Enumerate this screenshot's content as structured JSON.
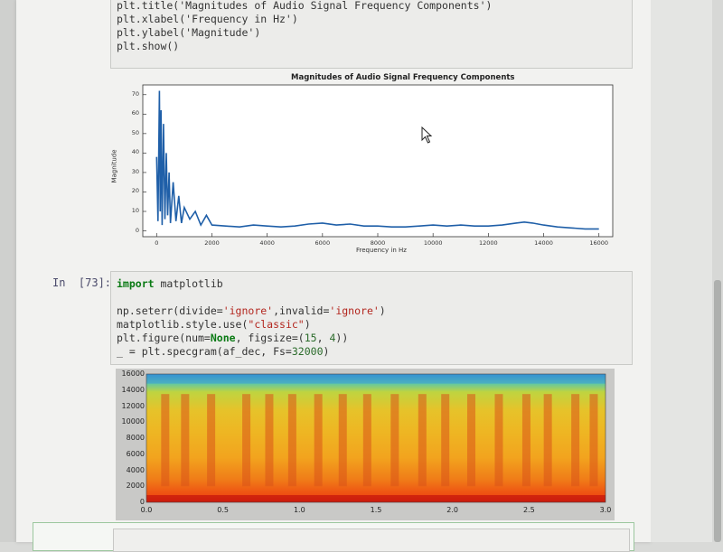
{
  "top_cell": {
    "lines": [
      "plt.title('Magnitudes of Audio Signal Frequency Components')",
      "plt.xlabel('Frequency in Hz')",
      "plt.ylabel('Magnitude')",
      "plt.show()"
    ]
  },
  "cell73": {
    "prompt": "In  [73]:",
    "line1_kw": "import",
    "line1_rest": " matplotlib",
    "line2_a": "np.seterr(divide=",
    "line2_s1": "'ignore'",
    "line2_b": ",invalid=",
    "line2_s2": "'ignore'",
    "line2_c": ")",
    "line3_a": "matplotlib.style.use(",
    "line3_s": "\"classic\"",
    "line3_c": ")",
    "line4_a": "plt.figure(num=",
    "line4_kw": "None",
    "line4_b": ", figsize=(",
    "line4_n1": "15",
    "line4_c": ", ",
    "line4_n2": "4",
    "line4_d": "))",
    "line5_a": "_ = plt.specgram(af_dec, Fs=",
    "line5_n": "32000",
    "line5_c": ")"
  },
  "chart_data": [
    {
      "type": "line",
      "title": "Magnitudes of Audio Signal Frequency Components",
      "xlabel": "Frequency in Hz",
      "ylabel": "Magnitude",
      "xlim": [
        -500,
        16500
      ],
      "ylim": [
        -3,
        75
      ],
      "xticks": [
        "0",
        "2000",
        "4000",
        "6000",
        "8000",
        "10000",
        "12000",
        "14000",
        "16000"
      ],
      "yticks": [
        "0",
        "10",
        "20",
        "30",
        "40",
        "50",
        "60",
        "70"
      ],
      "series": [
        {
          "x": [
            0,
            50,
            100,
            130,
            160,
            200,
            250,
            300,
            350,
            400,
            450,
            500,
            600,
            700,
            800,
            900,
            1000,
            1200,
            1400,
            1600,
            1800,
            2000,
            2500,
            3000,
            3500,
            4000,
            4500,
            5000,
            5500,
            6000,
            6500,
            7000,
            7500,
            8000,
            8500,
            9000,
            9500,
            10000,
            10500,
            11000,
            11500,
            12000,
            12500,
            13000,
            13300,
            13600,
            14000,
            14500,
            15000,
            15500,
            16000
          ],
          "y": [
            38,
            5,
            72,
            10,
            62,
            3,
            55,
            6,
            40,
            8,
            30,
            4,
            25,
            5,
            18,
            4,
            12,
            6,
            10,
            3,
            8,
            3,
            2.5,
            2,
            3,
            2.5,
            2,
            2.5,
            3.5,
            4,
            3,
            3.5,
            2.5,
            2.5,
            2,
            2,
            2.5,
            3,
            2.5,
            3,
            2.5,
            2.5,
            3,
            4,
            4.5,
            4,
            3,
            2,
            1.5,
            1,
            1
          ]
        }
      ],
      "color": "#1f5fa8",
      "grid": false
    },
    {
      "type": "heatmap",
      "title": "",
      "xlim": [
        0,
        3.0
      ],
      "ylim": [
        0,
        16000
      ],
      "xticks": [
        "0.0",
        "0.5",
        "1.0",
        "1.5",
        "2.0",
        "2.5",
        "3.0"
      ],
      "yticks": [
        "0",
        "2000",
        "4000",
        "6000",
        "8000",
        "10000",
        "12000",
        "14000",
        "16000"
      ],
      "colormap": "jet",
      "note": "spectrogram"
    }
  ],
  "next_cell": {
    "text": ""
  }
}
